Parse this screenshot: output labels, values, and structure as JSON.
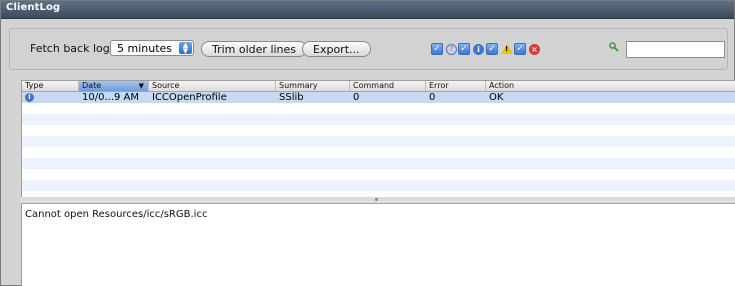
{
  "window": {
    "title": "ClientLog"
  },
  "toolbar": {
    "fetch_label": "Fetch back log:",
    "fetch_value": "5 minutes",
    "trim_label": "Trim older lines",
    "export_label": "Export...",
    "filters": [
      {
        "name": "help",
        "checked": true
      },
      {
        "name": "info",
        "checked": true
      },
      {
        "name": "warning",
        "checked": true
      },
      {
        "name": "error",
        "checked": true
      }
    ],
    "search_value": ""
  },
  "table": {
    "columns": [
      "Type",
      "Date",
      "Source",
      "Summary",
      "Command",
      "Error",
      "Action"
    ],
    "sorted_column": "Date",
    "rows": [
      {
        "type_icon": "info-icon",
        "date": "10/0...9 AM",
        "source": "ICCOpenProfile",
        "summary": "SSlib",
        "command": "0",
        "error": "0",
        "action": "OK"
      }
    ]
  },
  "detail": {
    "text": "Cannot open Resources/icc/sRGB.icc"
  },
  "colors": {
    "selection": "#c8d9f4",
    "alt_row": "#edf3fe",
    "title_bar": "#4b596b",
    "accent": "#3c78cf"
  }
}
